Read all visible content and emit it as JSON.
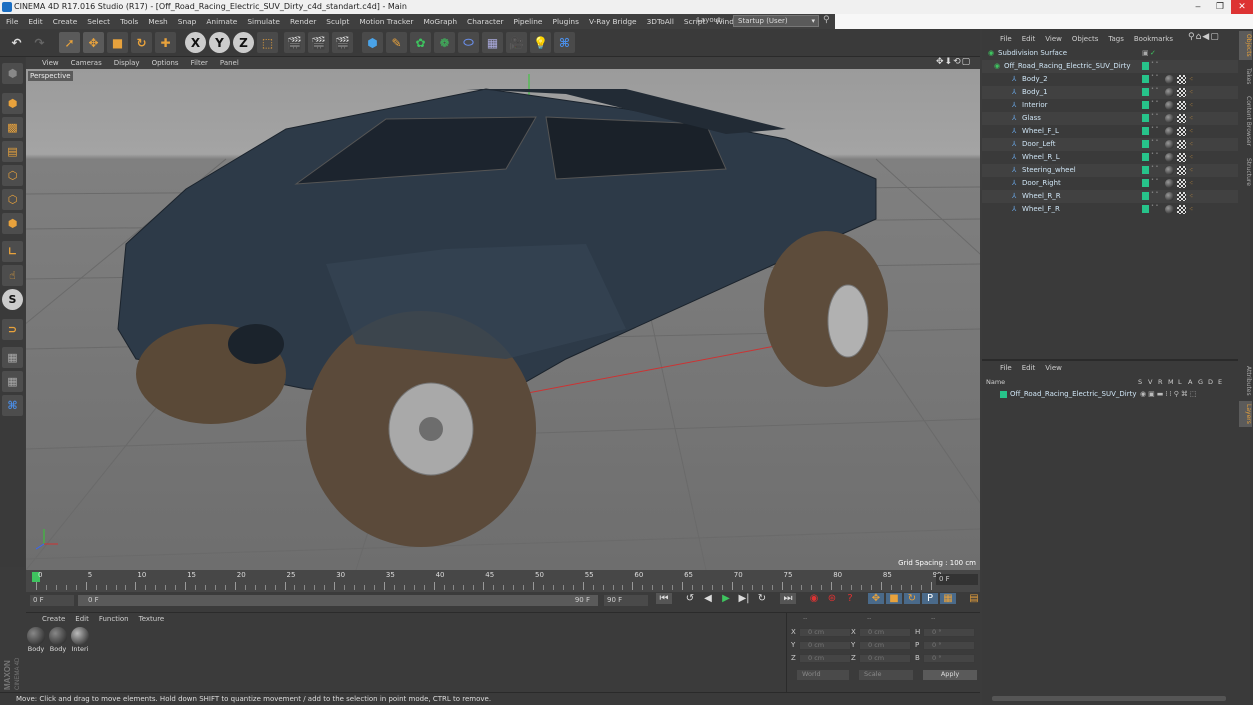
{
  "window": {
    "title": "CINEMA 4D R17.016 Studio (R17) - [Off_Road_Racing_Electric_SUV_Dirty_c4d_standart.c4d] - Main"
  },
  "menubar": {
    "items": [
      "File",
      "Edit",
      "Create",
      "Select",
      "Tools",
      "Mesh",
      "Snap",
      "Animate",
      "Simulate",
      "Render",
      "Sculpt",
      "Motion Tracker",
      "MoGraph",
      "Character",
      "Pipeline",
      "Plugins",
      "V-Ray Bridge",
      "3DToAll",
      "Script",
      "Window"
    ],
    "layout_label": "Layout:",
    "layout_value": "Startup (User)"
  },
  "toolbar": {
    "x_label": "X",
    "y_label": "Y",
    "z_label": "Z"
  },
  "lefttools": {
    "s_label": "S"
  },
  "viewport": {
    "menu": [
      "View",
      "Cameras",
      "Display",
      "Options",
      "Filter",
      "Panel"
    ],
    "label": "Perspective",
    "grid_spacing": "Grid Spacing : 100 cm"
  },
  "timeline": {
    "ticks": [
      "0",
      "5",
      "10",
      "15",
      "20",
      "25",
      "30",
      "35",
      "40",
      "45",
      "50",
      "55",
      "60",
      "65",
      "70",
      "75",
      "80",
      "85",
      "90"
    ],
    "end_field": "0 F",
    "start_frame": "0 F",
    "range_start": "0 F",
    "range_end": "90 F",
    "max_frame": "90 F",
    "max_frame2": "90 F"
  },
  "materials": {
    "menu": [
      "Create",
      "Edit",
      "Function",
      "Texture"
    ],
    "items": [
      {
        "name": "Body"
      },
      {
        "name": "Body"
      },
      {
        "name": "Interi"
      }
    ]
  },
  "coordinates": {
    "rows": [
      {
        "a": "X",
        "av": "0 cm",
        "b": "X",
        "bv": "0 cm",
        "c": "H",
        "cv": "0 °"
      },
      {
        "a": "Y",
        "av": "0 cm",
        "b": "Y",
        "bv": "0 cm",
        "c": "P",
        "cv": "0 °"
      },
      {
        "a": "Z",
        "av": "0 cm",
        "b": "Z",
        "bv": "0 cm",
        "c": "B",
        "cv": "0 °"
      }
    ],
    "world": "World",
    "scale": "Scale",
    "apply": "Apply",
    "dashes": [
      "--",
      "--",
      "--"
    ]
  },
  "statusbar": {
    "text": "Move: Click and drag to move elements. Hold down SHIFT to quantize movement / add to the selection in point mode, CTRL to remove."
  },
  "objects": {
    "menu": [
      "File",
      "Edit",
      "View",
      "Objects",
      "Tags",
      "Bookmarks"
    ],
    "tree": [
      {
        "name": "Subdivision Surface"
      },
      {
        "name": "Off_Road_Racing_Electric_SUV_Dirty"
      },
      {
        "name": "Body_2"
      },
      {
        "name": "Body_1"
      },
      {
        "name": "Interior"
      },
      {
        "name": "Glass"
      },
      {
        "name": "Wheel_F_L"
      },
      {
        "name": "Door_Left"
      },
      {
        "name": "Wheel_R_L"
      },
      {
        "name": "Steering_wheel"
      },
      {
        "name": "Door_Right"
      },
      {
        "name": "Wheel_R_R"
      },
      {
        "name": "Wheel_F_R"
      }
    ]
  },
  "layers": {
    "menu": [
      "File",
      "Edit",
      "View"
    ],
    "columns": [
      "Name",
      "S",
      "V",
      "R",
      "M",
      "L",
      "A",
      "G",
      "D",
      "E"
    ],
    "rows": [
      {
        "name": "Off_Road_Racing_Electric_SUV_Dirty"
      }
    ]
  },
  "right_tabs": [
    "Objects",
    "Takes",
    "Content Browser",
    "Structure",
    "Attributes",
    "Layers"
  ],
  "colors": {
    "accent_green": "#27c38a",
    "viewport_bg": "#7a7a7a",
    "highlight_orange": "#e8a23c"
  }
}
